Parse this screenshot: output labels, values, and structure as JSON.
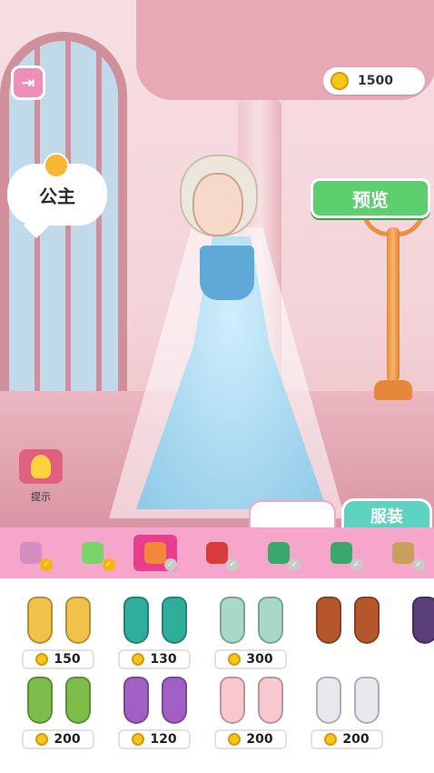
{
  "hud": {
    "coins": "1500",
    "character_label": "公主",
    "preview_label": "预览",
    "hint_label": "提示",
    "tab_outfit_label": "服装"
  },
  "categories": [
    {
      "icon": "hair-icon",
      "done": true
    },
    {
      "icon": "dress-icon",
      "done": true
    },
    {
      "icon": "shoes-icon",
      "done": false,
      "active": true
    },
    {
      "icon": "heels-icon",
      "done": false
    },
    {
      "icon": "necklace-icon",
      "done": false
    },
    {
      "icon": "earrings-icon",
      "done": false
    },
    {
      "icon": "bracelet-icon",
      "done": false
    }
  ],
  "items": [
    {
      "price": "150",
      "color": "#f0c24a"
    },
    {
      "price": "130",
      "color": "#2fae9c"
    },
    {
      "price": "300",
      "color": "#a8d9c8"
    },
    {
      "price": "",
      "color": "#b5562c"
    },
    {
      "price": "",
      "color": "#5b3f7a"
    },
    {
      "price": "200",
      "color": "#7cbd4a"
    },
    {
      "price": "120",
      "color": "#a25fc4"
    },
    {
      "price": "200",
      "color": "#f7c9cf"
    },
    {
      "price": "200",
      "color": "#e8e8ee"
    }
  ],
  "colors": {
    "accent_pink": "#f6a6ca",
    "active_pink": "#e83e8c",
    "preview_green": "#5ecf6f",
    "outfit_teal": "#5dd2c0"
  }
}
